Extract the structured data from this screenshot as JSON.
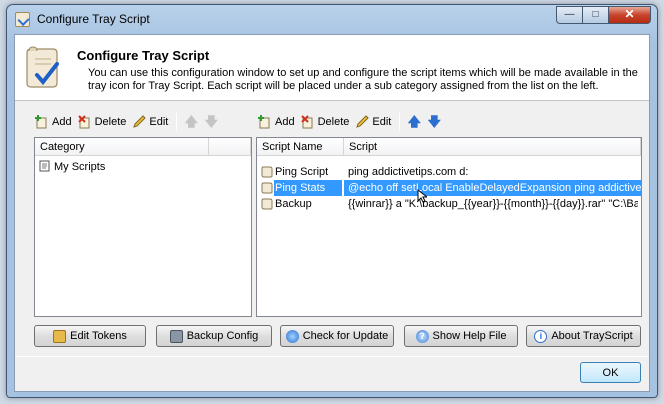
{
  "window": {
    "title": "Configure Tray Script"
  },
  "header": {
    "title": "Configure Tray Script",
    "description": "You can use this configuration window to set up and configure the script items which will be made available in the tray icon for Tray Script. Each script will be placed under a sub category assigned from the list on the left."
  },
  "left_toolbar": {
    "add": "Add",
    "delete": "Delete",
    "edit": "Edit"
  },
  "right_toolbar": {
    "add": "Add",
    "delete": "Delete",
    "edit": "Edit"
  },
  "category_list": {
    "header": "Category",
    "items": [
      "My Scripts"
    ]
  },
  "script_list": {
    "headers": [
      "Script Name",
      "Script"
    ],
    "rows": [
      {
        "name": "Ping Script",
        "script": "ping addictivetips.com d:"
      },
      {
        "name": "Ping Stats",
        "script": "@echo off setLocal EnableDelayedExpansion ping addictivetips...."
      },
      {
        "name": "Backup",
        "script": "{{winrar}} a \"K:\\backup_{{year}}-{{month}}-{{day}}.rar\" \"C:\\Back...."
      }
    ],
    "selected_index": 1
  },
  "buttons": {
    "edit_tokens": "Edit Tokens",
    "backup_config": "Backup Config",
    "check_update": "Check for Update",
    "show_help": "Show Help File",
    "about": "About TrayScript",
    "ok": "OK"
  },
  "colors": {
    "selection": "#3399ff",
    "accent": "#2c6fd0"
  }
}
